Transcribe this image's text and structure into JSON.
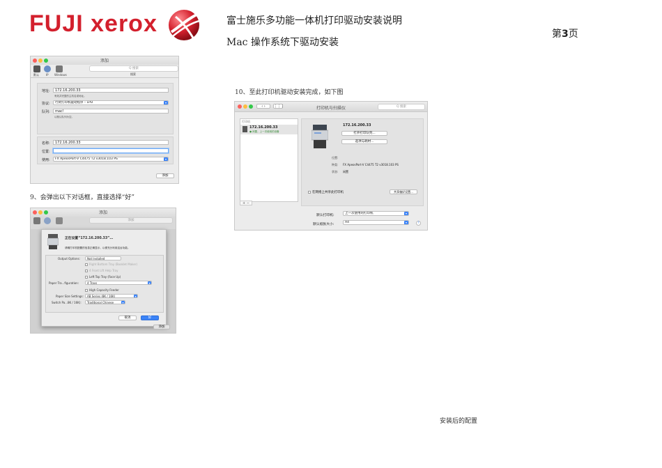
{
  "header": {
    "logo_text": "FUJI xerox",
    "doc_title": "富士施乐多功能一体机打印驱动安装说明",
    "doc_subtitle": "Mac 操作系统下驱动安装",
    "page_prefix": "第",
    "page_number": "3",
    "page_suffix": "页"
  },
  "colors": {
    "brand_red": "#d3202d",
    "mac_blue": "#3b83f7"
  },
  "step9": {
    "caption": "9、会弹出以下对话框，直接选择“好”"
  },
  "step10": {
    "caption": "10、至此打印机驱动安装完成，如下图"
  },
  "bottom_caption": "安装后的配置",
  "add_window": {
    "title": "添加",
    "toolbar": [
      {
        "label": "默认",
        "icon": "printer-icon"
      },
      {
        "label": "IP",
        "icon": "globe-icon"
      },
      {
        "label": "Windows",
        "icon": "printer-icon"
      }
    ],
    "search_placeholder": "Q 搜索",
    "search_label": "搜索",
    "address_label": "地址:",
    "address_value": "172.16.200.33",
    "address_hint": "有效并完整的主机名或地址。",
    "protocol_label": "协议:",
    "protocol_value": "行式打印机驱动程序 – LPD",
    "queue_label": "队列:",
    "queue_value": "mac!",
    "queue_hint": "以默认队列为空。",
    "name_label": "名称:",
    "name_value": "172.16.200.33",
    "location_label": "位置:",
    "location_value": "",
    "use_label": "使用:",
    "use_value": "FX ApeosPort-V C4475 T2 v3018.103 PS",
    "add_button": "添加"
  },
  "setup_dialog": {
    "title": "添加",
    "heading": "正在设置“172.16.200.33”…",
    "description": "请确打印机配置的信息正确显示，以便充分利用这台功能。",
    "output_label": "Output Options:",
    "output_value": "Not Installed",
    "options_dim": [
      "Right Bottom Tray (Booklet Maker)",
      "4 Front Lift Help Tray"
    ],
    "left_tray": "Left Top Tray (Face Up)",
    "paper_tray_label": "Paper Tra...figuration:",
    "paper_tray_value": "4 Trays",
    "high_capacity": "High Capacity Feeder",
    "paper_size_label": "Paper Size Settings:",
    "paper_size_value": "AB Series (8K / 16K)",
    "switch_label": "Switch Pa...8K / 16K):",
    "switch_value": "Traditional Chinese",
    "cancel_button": "取消",
    "ok_button": "好",
    "behind_button": "添加"
  },
  "printers_window": {
    "title": "打印机与扫描仪",
    "search_placeholder": "Q 搜索",
    "list_header": "打印机",
    "printer_name": "172.16.200.33",
    "printer_status": "● 闲置，上一次使用的设备",
    "detail_name": "172.16.200.33",
    "open_queue_button": "打开打印队列...",
    "options_button": "选项与耗材...",
    "location_label": "位置:",
    "location_value": "",
    "kind_label": "种类:",
    "kind_value": "FX ApeosPort-V C4475 T2 v3018.103 PS",
    "status_label": "状态:",
    "status_value": "闲置",
    "share_label": "在网络上共享此打印机",
    "share_prefs_button": "共享偏好设置...",
    "default_printer_label": "默认打印机:",
    "default_printer_value": "上一次使用的打印机",
    "default_paper_label": "默认纸张大小:",
    "default_paper_value": "A4",
    "add_remove": "+ −",
    "help": "?"
  }
}
